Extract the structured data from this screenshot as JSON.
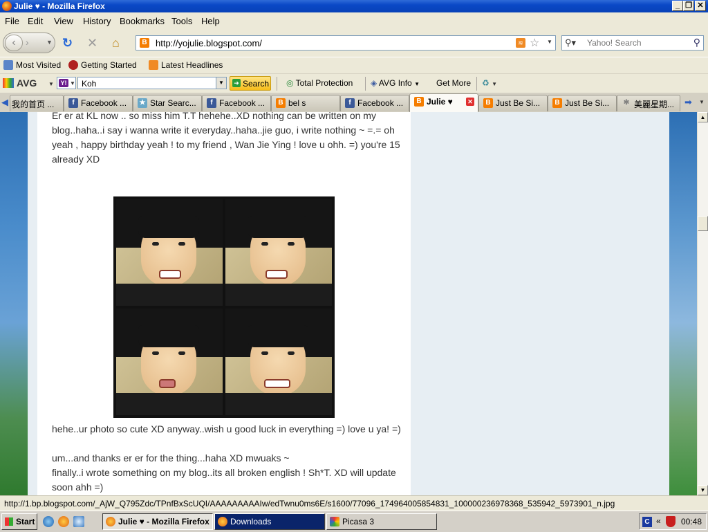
{
  "window": {
    "title": "Julie ♥ - Mozilla Firefox",
    "min": "_",
    "max": "❐",
    "close": "✕"
  },
  "menu": [
    "File",
    "Edit",
    "View",
    "History",
    "Bookmarks",
    "Tools",
    "Help"
  ],
  "nav": {
    "url": "http://yojulie.blogspot.com/",
    "search_placeholder": "Yahoo! Search"
  },
  "bookmarks": [
    "Most Visited",
    "Getting Started",
    "Latest Headlines"
  ],
  "toolbar": {
    "avg": "AVG",
    "search_value": "Koh",
    "search_button": "Search",
    "total_protection": "Total Protection",
    "avg_info": "AVG Info",
    "get_more": "Get More"
  },
  "tabs": [
    {
      "label": "我的首页 ...",
      "icon": "home"
    },
    {
      "label": "Facebook ...",
      "icon": "facebook"
    },
    {
      "label": "Star Searc...",
      "icon": "star"
    },
    {
      "label": "Facebook ...",
      "icon": "facebook"
    },
    {
      "label": "bel s",
      "icon": "blogger"
    },
    {
      "label": "Facebook ...",
      "icon": "facebook"
    },
    {
      "label": "Julie ♥",
      "icon": "blogger",
      "active": true
    },
    {
      "label": "Just Be Si...",
      "icon": "blogger"
    },
    {
      "label": "Just Be Si...",
      "icon": "blogger"
    },
    {
      "label": "美麗星期...",
      "icon": "loading"
    }
  ],
  "post": {
    "p1": "Er er at KL now .. so miss him T.T hehehe..XD nothing can be written on my blog..haha..i say i wanna write it everyday..haha..jie guo, i write nothing ~ =.= oh yeah , happy birthday yeah ! to my friend , Wan Jie Ying ! love u ohh. =) you're 15 already XD",
    "p2": "hehe..ur photo so cute XD anyway..wish u good luck in everything =) love u ya! =)",
    "p3": "um...and thanks er er for the thing...haha XD mwuaks ~",
    "p4": "finally..i wrote something on my blog..its all broken english ! Sh*T. XD will update soon ahh =)"
  },
  "status": "http://1.bp.blogspot.com/_AjW_Q795Zdc/TPnfBxScUQI/AAAAAAAAAIw/edTwnu0ms6E/s1600/77096_174964005854831_100000236978368_535942_5973901_n.jpg",
  "taskbar": {
    "start": "Start",
    "tasks": [
      "Julie ♥ - Mozilla Firefox",
      "Downloads",
      "Picasa 3"
    ],
    "clock": "00:48"
  }
}
